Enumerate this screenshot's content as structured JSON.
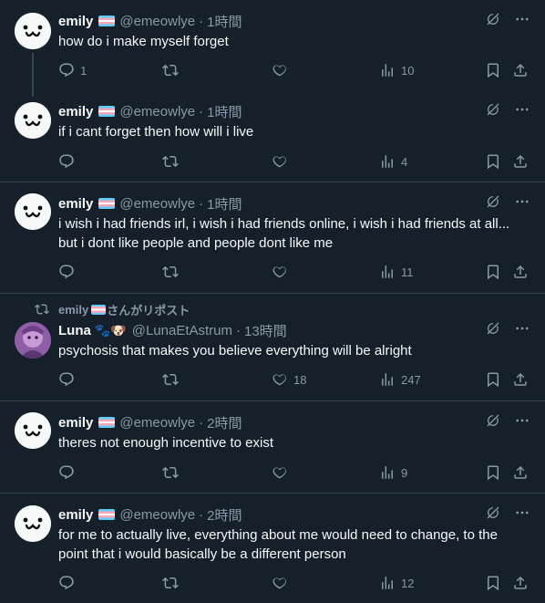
{
  "colors": {
    "background": "#15202b",
    "text": "#f7f9f9",
    "muted": "#8b98a5",
    "divider": "#38444d"
  },
  "posts": [
    {
      "name": "emily",
      "handle": "@emeowlye",
      "dot": "·",
      "time": "1時間",
      "text": "how do i make myself forget",
      "replies": "1",
      "retweets": "",
      "likes": "",
      "views": "10"
    },
    {
      "name": "emily",
      "handle": "@emeowlye",
      "dot": "·",
      "time": "1時間",
      "text": "if i cant forget then how will i live",
      "replies": "",
      "retweets": "",
      "likes": "",
      "views": "4"
    },
    {
      "name": "emily",
      "handle": "@emeowlye",
      "dot": "·",
      "time": "1時間",
      "text": "i wish i had friends irl, i wish i had friends online, i wish i had friends at all... but i dont like people and people dont like me",
      "replies": "",
      "retweets": "",
      "likes": "",
      "views": "11"
    },
    {
      "repost_by": "emily",
      "repost_suffix": "さんがリポスト",
      "name": "Luna",
      "name_emoji": "🐾🐶",
      "handle": "@LunaEtAstrum",
      "dot": "·",
      "time": "13時間",
      "text": "psychosis that makes you believe everything will be alright",
      "replies": "",
      "retweets": "",
      "likes": "18",
      "views": "247"
    },
    {
      "name": "emily",
      "handle": "@emeowlye",
      "dot": "·",
      "time": "2時間",
      "text": "theres not enough incentive to exist",
      "replies": "",
      "retweets": "",
      "likes": "",
      "views": "9"
    },
    {
      "name": "emily",
      "handle": "@emeowlye",
      "dot": "·",
      "time": "2時間",
      "text": "for me to actually live, everything about me would need to change, to the point that i would basically be a different person",
      "replies": "",
      "retweets": "",
      "likes": "",
      "views": "12"
    }
  ]
}
